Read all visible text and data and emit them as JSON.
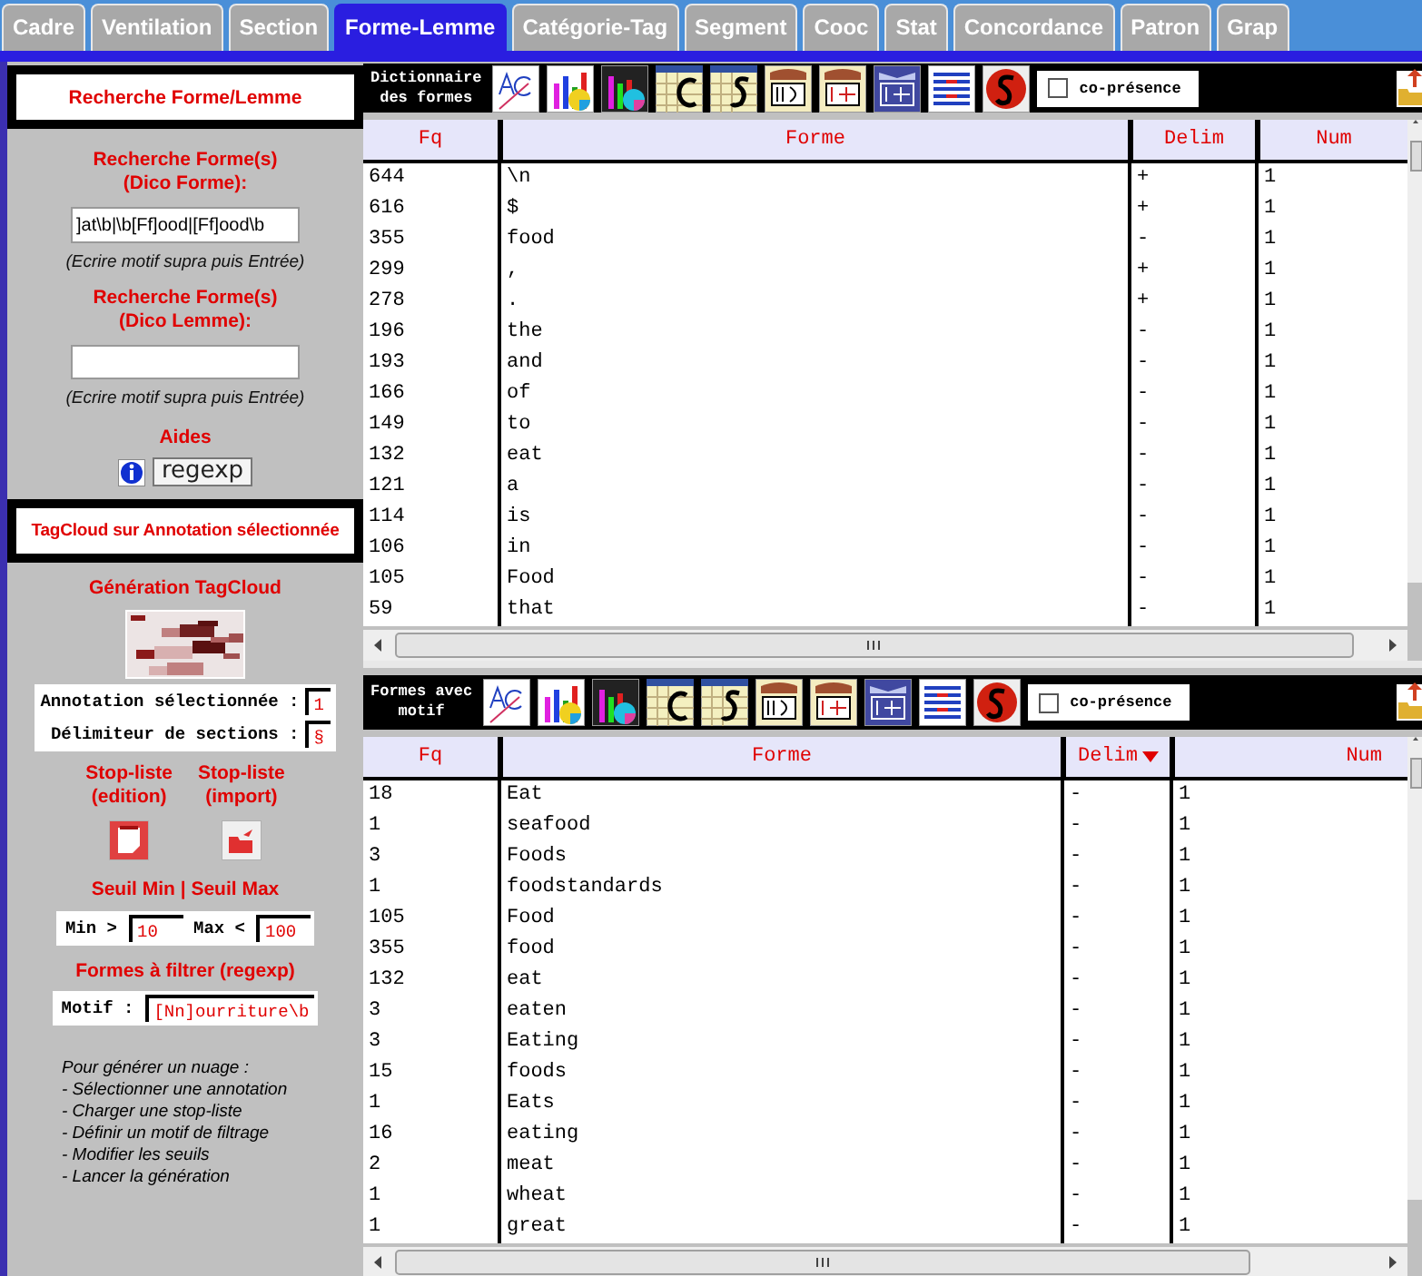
{
  "tabs": [
    {
      "label": "Cadre",
      "selected": false
    },
    {
      "label": "Ventilation",
      "selected": false
    },
    {
      "label": "Section",
      "selected": false
    },
    {
      "label": "Forme-Lemme",
      "selected": true
    },
    {
      "label": "Catégorie-Tag",
      "selected": false
    },
    {
      "label": "Segment",
      "selected": false
    },
    {
      "label": "Cooc",
      "selected": false
    },
    {
      "label": "Stat",
      "selected": false
    },
    {
      "label": "Concordance",
      "selected": false
    },
    {
      "label": "Patron",
      "selected": false
    },
    {
      "label": "Grap",
      "selected": false
    }
  ],
  "sidebar": {
    "search_title": "Recherche Forme/Lemme",
    "forme_label": "Recherche Forme(s)\n(Dico Forme):",
    "forme_value": "]at\\b|\\b[Ff]ood|[Ff]ood\\b",
    "forme_hint": "(Ecrire motif supra puis Entrée)",
    "lemme_label": "Recherche Forme(s)\n(Dico Lemme):",
    "lemme_hint": "(Ecrire motif supra puis Entrée)",
    "aides_label": "Aides",
    "regexp_button": "regexp",
    "tagcloud_title": "TagCloud sur Annotation sélectionnée",
    "generation_label": "Génération TagCloud",
    "annotation_label": "Annotation sélectionnée :",
    "annotation_value": "1",
    "delimiter_label": "Délimiteur de sections :",
    "delimiter_value": "§",
    "stoplist_edit_label": "Stop-liste\n(edition)",
    "stoplist_import_label": "Stop-liste\n(import)",
    "threshold_label": "Seuil Min | Seuil Max",
    "min_label": "Min >",
    "min_value": "10",
    "max_label": "Max <",
    "max_value": "100",
    "filter_label": "Formes à filtrer (regexp)",
    "motif_label": "Motif :",
    "motif_value": "[Nn]ourriture\\b",
    "instructions": [
      "Pour générer un nuage :",
      "- Sélectionner une annotation",
      "- Charger une stop-liste",
      "- Définir un motif de filtrage",
      "- Modifier les seuils",
      "- Lancer la génération"
    ]
  },
  "panels": [
    {
      "title": "Dictionnaire\ndes formes",
      "copresence": {
        "label": "co-présence",
        "checked": false
      },
      "columns": [
        {
          "label": "Fq",
          "sorted": false
        },
        {
          "label": "Forme",
          "sorted": false
        },
        {
          "label": "Delim",
          "sorted": false
        },
        {
          "label": "Num",
          "sorted": false
        }
      ],
      "rows": [
        [
          "644",
          "\\n",
          "+",
          "1"
        ],
        [
          "616",
          "$",
          "+",
          "1"
        ],
        [
          "355",
          "food",
          "-",
          "1"
        ],
        [
          "299",
          ",",
          "+",
          "1"
        ],
        [
          "278",
          ".",
          "+",
          "1"
        ],
        [
          "196",
          "the",
          "-",
          "1"
        ],
        [
          "193",
          "and",
          "-",
          "1"
        ],
        [
          "166",
          "of",
          "-",
          "1"
        ],
        [
          "149",
          "to",
          "-",
          "1"
        ],
        [
          "132",
          "eat",
          "-",
          "1"
        ],
        [
          "121",
          "a",
          "-",
          "1"
        ],
        [
          "114",
          "is",
          "-",
          "1"
        ],
        [
          "106",
          "in",
          "-",
          "1"
        ],
        [
          "105",
          "Food",
          "-",
          "1"
        ],
        [
          "59",
          "that",
          "-",
          "1"
        ]
      ]
    },
    {
      "title": "Formes avec\nmotif",
      "copresence": {
        "label": "co-présence",
        "checked": false
      },
      "columns": [
        {
          "label": "Fq",
          "sorted": false
        },
        {
          "label": "Forme",
          "sorted": false
        },
        {
          "label": "Delim",
          "sorted": true
        },
        {
          "label": "Num",
          "sorted": false
        }
      ],
      "rows": [
        [
          "18",
          "Eat",
          "-",
          "1"
        ],
        [
          "1",
          "seafood",
          "-",
          "1"
        ],
        [
          "3",
          "Foods",
          "-",
          "1"
        ],
        [
          "1",
          "foodstandards",
          "-",
          "1"
        ],
        [
          "105",
          "Food",
          "-",
          "1"
        ],
        [
          "355",
          "food",
          "-",
          "1"
        ],
        [
          "132",
          "eat",
          "-",
          "1"
        ],
        [
          "3",
          "eaten",
          "-",
          "1"
        ],
        [
          "3",
          "Eating",
          "-",
          "1"
        ],
        [
          "15",
          "foods",
          "-",
          "1"
        ],
        [
          "1",
          "Eats",
          "-",
          "1"
        ],
        [
          "16",
          "eating",
          "-",
          "1"
        ],
        [
          "2",
          "meat",
          "-",
          "1"
        ],
        [
          "1",
          "wheat",
          "-",
          "1"
        ],
        [
          "1",
          "great",
          "-",
          "1"
        ]
      ]
    }
  ]
}
